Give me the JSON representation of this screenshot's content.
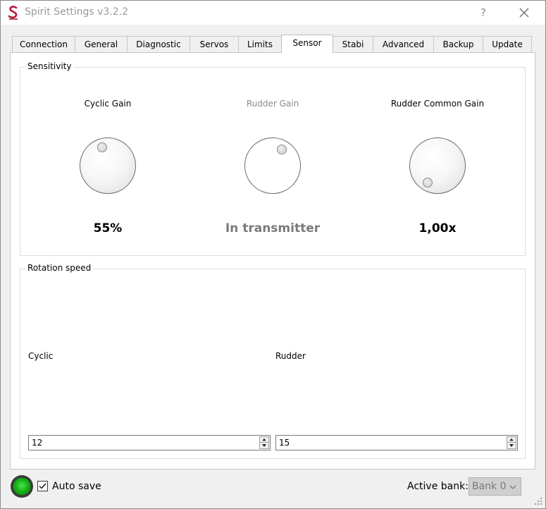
{
  "window": {
    "title": "Spirit Settings v3.2.2",
    "help_label": "?"
  },
  "tabs": [
    {
      "label": "Connection"
    },
    {
      "label": "General"
    },
    {
      "label": "Diagnostic"
    },
    {
      "label": "Servos"
    },
    {
      "label": "Limits"
    },
    {
      "label": "Sensor"
    },
    {
      "label": "Stabi"
    },
    {
      "label": "Advanced"
    },
    {
      "label": "Backup"
    },
    {
      "label": "Update"
    }
  ],
  "active_tab": "Sensor",
  "sensitivity": {
    "title": "Sensitivity",
    "knobs": [
      {
        "label": "Cyclic Gain",
        "value": "55%",
        "enabled": true
      },
      {
        "label": "Rudder Gain",
        "value": "In transmitter",
        "enabled": false
      },
      {
        "label": "Rudder Common Gain",
        "value": "1,00x",
        "enabled": true
      }
    ]
  },
  "rotation_speed": {
    "title": "Rotation speed",
    "cyclic": {
      "label": "Cyclic",
      "value": "12"
    },
    "rudder": {
      "label": "Rudder",
      "value": "15"
    }
  },
  "footer": {
    "auto_save_label": "Auto save",
    "auto_save_checked": true,
    "active_bank_label": "Active bank:",
    "active_bank_value": "Bank 0"
  },
  "colors": {
    "status_led": "#17b617",
    "disabled_text": "#8a8a8a",
    "brand": "#b01a3a"
  }
}
